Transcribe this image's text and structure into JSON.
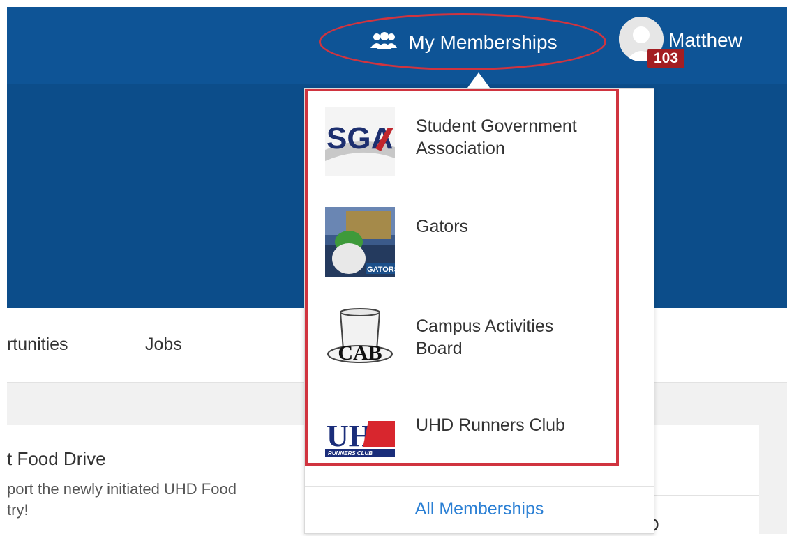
{
  "header": {
    "memberships_label": "My Memberships",
    "user_name": "Matthew",
    "notification_count": "103"
  },
  "nav": {
    "tabs": [
      "rtunities",
      "Jobs"
    ]
  },
  "content": {
    "card_title": "t Food Drive",
    "card_text_line1": "port the newly initiated UHD Food",
    "card_text_line2": "try!",
    "right_partial": "D"
  },
  "dropdown": {
    "items": [
      {
        "label_line1": "Student Government",
        "label_line2": "Association",
        "logo": "sga-logo"
      },
      {
        "label_line1": "Gators",
        "label_line2": "",
        "logo": "gators-logo"
      },
      {
        "label_line1": "Campus Activities",
        "label_line2": "Board",
        "logo": "cab-logo"
      },
      {
        "label_line1": "UHD Runners Club",
        "label_line2": "",
        "logo": "uhd-runners-logo"
      }
    ],
    "all_label": "All Memberships",
    "logo_text": {
      "sga": "SGA",
      "gators": "GATORS",
      "cab": "CAB",
      "uhd": "UHD",
      "uhd_sub": "RUNNERS CLUB"
    }
  },
  "colors": {
    "header_bg": "#0e5496",
    "hero_bg": "#0c4d8a",
    "annotation_red": "#d0343f",
    "badge_red": "#a31e22",
    "link_blue": "#2a7fd4"
  }
}
